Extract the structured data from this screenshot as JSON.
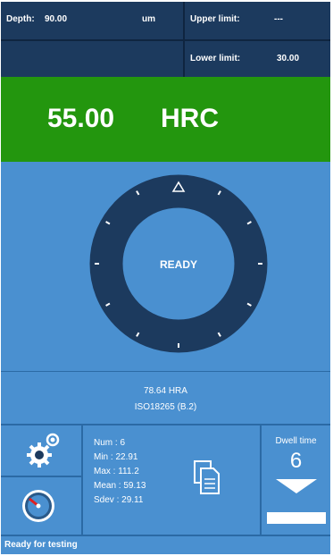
{
  "header": {
    "depth_label": "Depth:",
    "depth_value": "90.00",
    "depth_unit": "um",
    "upper_label": "Upper limit:",
    "upper_value": "---",
    "lower_label": "Lower limit:",
    "lower_value": "30.00"
  },
  "result": {
    "value": "55.00",
    "unit": "HRC"
  },
  "dial": {
    "state": "READY",
    "icon": "triangle-marker-icon"
  },
  "conversion": {
    "hra": "78.64 HRA",
    "standard": "ISO18265 (B.2)"
  },
  "stats": {
    "num": "Num  : 6",
    "min": "Min   : 22.91",
    "max": "Max  : 111.2",
    "mean": "Mean : 59.13",
    "sdev": "Sdev : 29.11"
  },
  "dwell": {
    "label": "Dwell time",
    "value": "6"
  },
  "status": {
    "text": "Ready for testing"
  },
  "icons": {
    "settings": "gears-icon",
    "gauge": "gauge-icon",
    "report": "report-icon",
    "dwell_arrow": "down-arrow-icon"
  },
  "colors": {
    "header_bg": "#1c3a5e",
    "result_bg": "#23960e",
    "panel_bg": "#4a90d0",
    "dial_ring": "#1c3a5e",
    "divider": "#2b6aa5"
  }
}
